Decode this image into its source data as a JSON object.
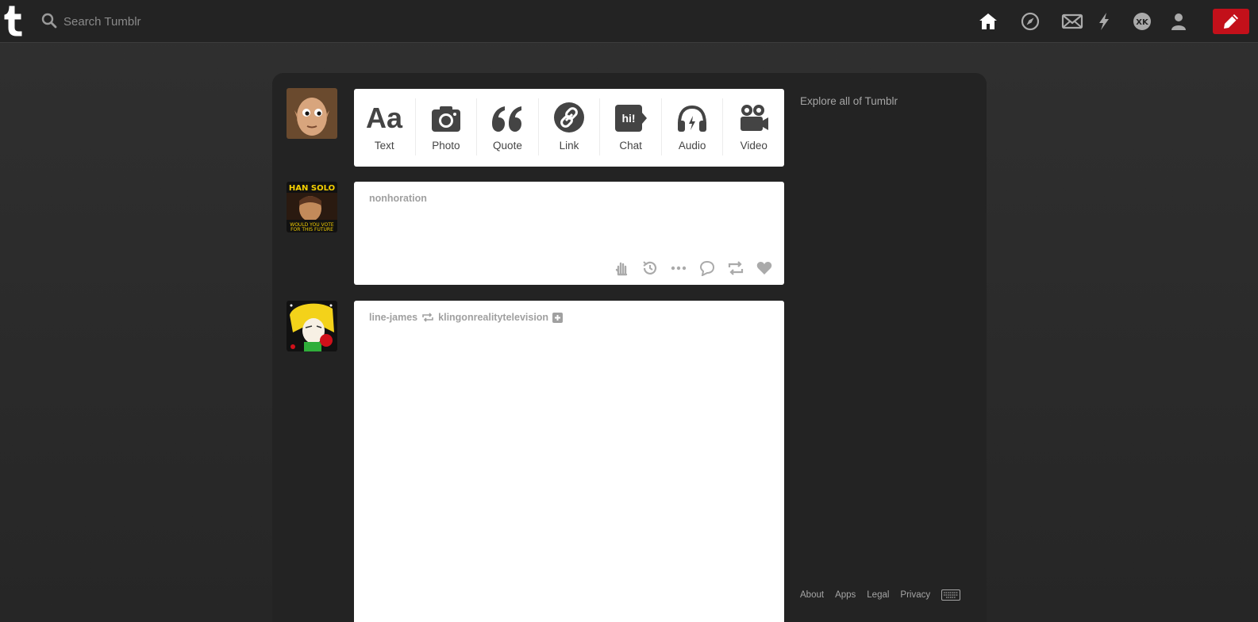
{
  "search": {
    "placeholder": "Search Tumblr"
  },
  "nav": {
    "icons": [
      "home-icon",
      "compass-icon",
      "envelope-icon",
      "lightning-icon",
      "xkit-icon",
      "person-icon",
      "pencil-icon"
    ]
  },
  "composer": {
    "types": [
      {
        "label": "Text",
        "icon": "text-aa-icon"
      },
      {
        "label": "Photo",
        "icon": "camera-icon"
      },
      {
        "label": "Quote",
        "icon": "quote-icon"
      },
      {
        "label": "Link",
        "icon": "link-icon"
      },
      {
        "label": "Chat",
        "icon": "chat-hi-icon"
      },
      {
        "label": "Audio",
        "icon": "headphones-icon"
      },
      {
        "label": "Video",
        "icon": "video-camera-icon"
      }
    ]
  },
  "posts": [
    {
      "author": "nonhoration"
    },
    {
      "author": "line-james",
      "reblogged_from": "klingonrealitytelevision"
    }
  ],
  "sidebar": {
    "explore_label": "Explore all of Tumblr",
    "footer_links": [
      "About",
      "Apps",
      "Legal",
      "Privacy"
    ]
  },
  "colors": {
    "background": "#2b2b2b",
    "topbar": "#232323",
    "compose_button": "#c3101a",
    "card": "#ffffff",
    "muted_text": "#a5a5a5"
  }
}
